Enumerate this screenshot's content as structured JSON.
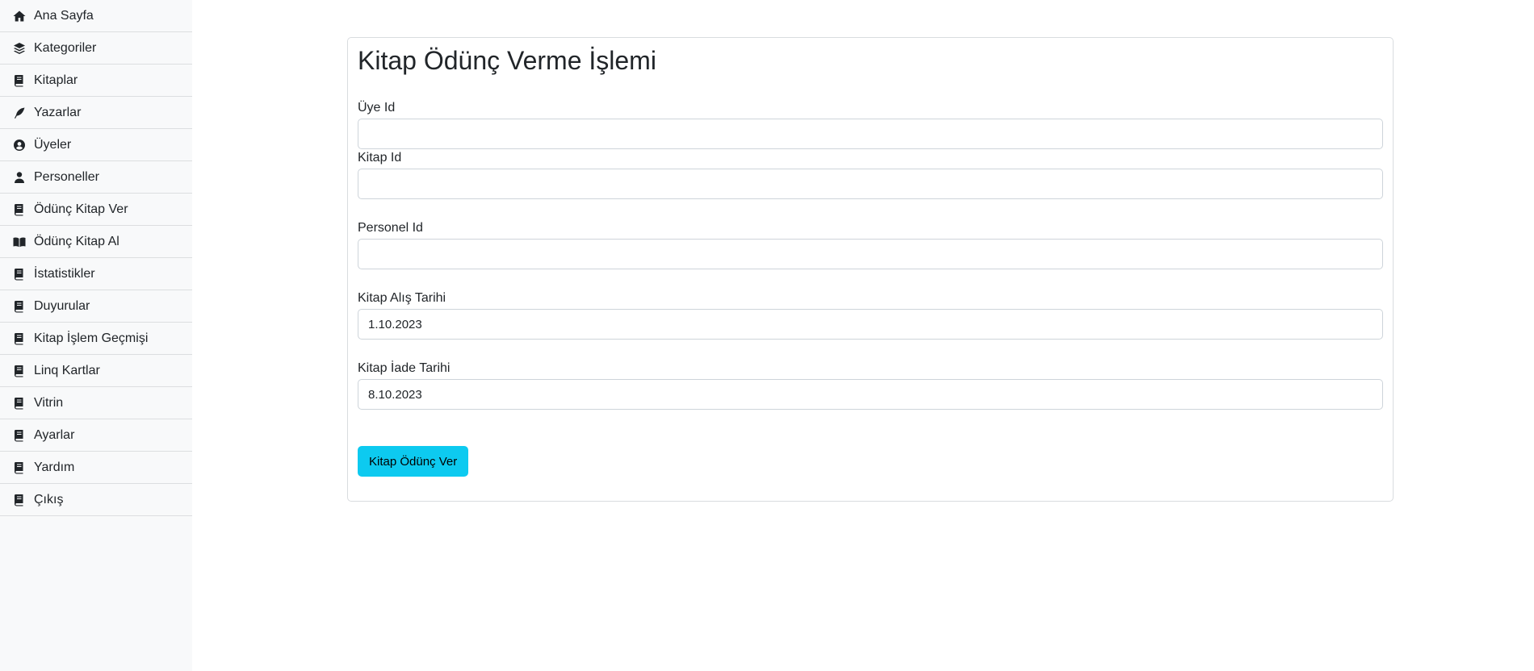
{
  "sidebar": {
    "items": [
      {
        "label": "Ana Sayfa",
        "icon": "home-icon"
      },
      {
        "label": "Kategoriler",
        "icon": "layers-icon"
      },
      {
        "label": "Kitaplar",
        "icon": "book-icon"
      },
      {
        "label": "Yazarlar",
        "icon": "feather-icon"
      },
      {
        "label": "Üyeler",
        "icon": "user-circle-icon"
      },
      {
        "label": "Personeller",
        "icon": "user-icon"
      },
      {
        "label": "Ödünç Kitap Ver",
        "icon": "book-icon"
      },
      {
        "label": "Ödünç Kitap Al",
        "icon": "book-open-icon"
      },
      {
        "label": "İstatistikler",
        "icon": "book-icon"
      },
      {
        "label": "Duyurular",
        "icon": "book-icon"
      },
      {
        "label": "Kitap İşlem Geçmişi",
        "icon": "book-icon"
      },
      {
        "label": "Linq Kartlar",
        "icon": "book-icon"
      },
      {
        "label": "Vitrin",
        "icon": "book-icon"
      },
      {
        "label": "Ayarlar",
        "icon": "book-icon"
      },
      {
        "label": "Yardım",
        "icon": "book-icon"
      },
      {
        "label": "Çıkış",
        "icon": "book-icon"
      }
    ]
  },
  "form": {
    "title": "Kitap Ödünç Verme İşlemi",
    "fields": {
      "uye_id": {
        "label": "Üye Id",
        "value": ""
      },
      "kitap_id": {
        "label": "Kitap Id",
        "value": ""
      },
      "personel_id": {
        "label": "Personel Id",
        "value": ""
      },
      "alis_tarihi": {
        "label": "Kitap Alış Tarihi",
        "value": "1.10.2023"
      },
      "iade_tarihi": {
        "label": "Kitap İade Tarihi",
        "value": "8.10.2023"
      }
    },
    "submit_label": "Kitap Ödünç Ver"
  },
  "colors": {
    "sidebar_bg": "#f8f9fa",
    "button_bg": "#0dcaf0",
    "border": "#ced4da"
  }
}
